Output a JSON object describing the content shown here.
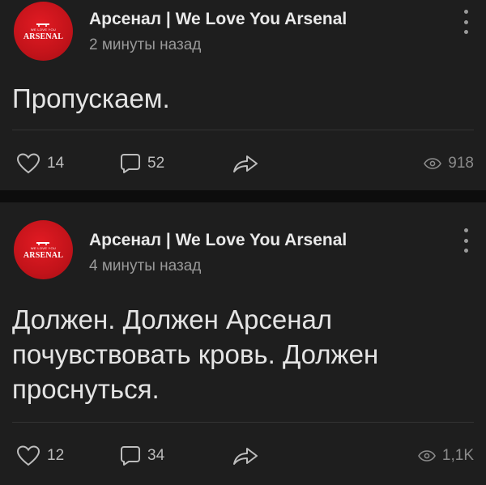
{
  "posts": [
    {
      "author": "Арсенал | We Love You Arsenal",
      "avatar": {
        "top_text": "WE LOVE YOU",
        "brand_text": "ARSENAL",
        "color": "#d81920"
      },
      "time": "2 минуты назад",
      "text": "Пропускаем.",
      "likes": "14",
      "comments": "52",
      "views": "918",
      "icons": [
        "heart-icon",
        "comment-icon",
        "share-icon",
        "eye-icon",
        "more-vertical-icon"
      ]
    },
    {
      "author": "Арсенал | We Love You Arsenal",
      "avatar": {
        "top_text": "WE LOVE YOU",
        "brand_text": "ARSENAL",
        "color": "#d81920"
      },
      "time": "4 минуты назад",
      "text": "Должен. Должен Арсенал\nпочувствовать кровь. Должен\nпроснуться.",
      "likes": "12",
      "comments": "34",
      "views": "1,1K",
      "icons": [
        "heart-icon",
        "comment-icon",
        "share-icon",
        "eye-icon",
        "more-vertical-icon"
      ]
    }
  ]
}
